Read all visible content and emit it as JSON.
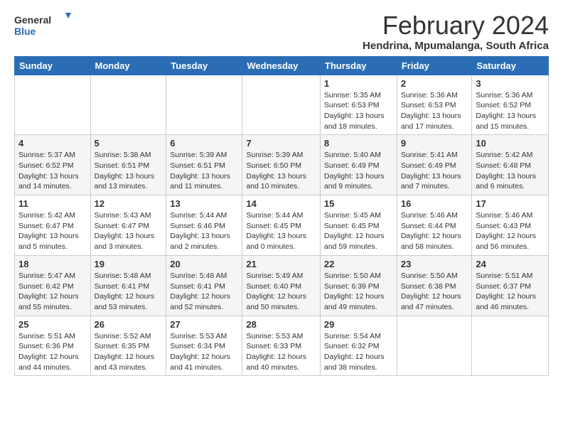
{
  "logo": {
    "general": "General",
    "blue": "Blue"
  },
  "title": "February 2024",
  "subtitle": "Hendrina, Mpumalanga, South Africa",
  "days_header": [
    "Sunday",
    "Monday",
    "Tuesday",
    "Wednesday",
    "Thursday",
    "Friday",
    "Saturday"
  ],
  "weeks": [
    [
      {
        "num": "",
        "info": ""
      },
      {
        "num": "",
        "info": ""
      },
      {
        "num": "",
        "info": ""
      },
      {
        "num": "",
        "info": ""
      },
      {
        "num": "1",
        "info": "Sunrise: 5:35 AM\nSunset: 6:53 PM\nDaylight: 13 hours and 18 minutes."
      },
      {
        "num": "2",
        "info": "Sunrise: 5:36 AM\nSunset: 6:53 PM\nDaylight: 13 hours and 17 minutes."
      },
      {
        "num": "3",
        "info": "Sunrise: 5:36 AM\nSunset: 6:52 PM\nDaylight: 13 hours and 15 minutes."
      }
    ],
    [
      {
        "num": "4",
        "info": "Sunrise: 5:37 AM\nSunset: 6:52 PM\nDaylight: 13 hours and 14 minutes."
      },
      {
        "num": "5",
        "info": "Sunrise: 5:38 AM\nSunset: 6:51 PM\nDaylight: 13 hours and 13 minutes."
      },
      {
        "num": "6",
        "info": "Sunrise: 5:39 AM\nSunset: 6:51 PM\nDaylight: 13 hours and 11 minutes."
      },
      {
        "num": "7",
        "info": "Sunrise: 5:39 AM\nSunset: 6:50 PM\nDaylight: 13 hours and 10 minutes."
      },
      {
        "num": "8",
        "info": "Sunrise: 5:40 AM\nSunset: 6:49 PM\nDaylight: 13 hours and 9 minutes."
      },
      {
        "num": "9",
        "info": "Sunrise: 5:41 AM\nSunset: 6:49 PM\nDaylight: 13 hours and 7 minutes."
      },
      {
        "num": "10",
        "info": "Sunrise: 5:42 AM\nSunset: 6:48 PM\nDaylight: 13 hours and 6 minutes."
      }
    ],
    [
      {
        "num": "11",
        "info": "Sunrise: 5:42 AM\nSunset: 6:47 PM\nDaylight: 13 hours and 5 minutes."
      },
      {
        "num": "12",
        "info": "Sunrise: 5:43 AM\nSunset: 6:47 PM\nDaylight: 13 hours and 3 minutes."
      },
      {
        "num": "13",
        "info": "Sunrise: 5:44 AM\nSunset: 6:46 PM\nDaylight: 13 hours and 2 minutes."
      },
      {
        "num": "14",
        "info": "Sunrise: 5:44 AM\nSunset: 6:45 PM\nDaylight: 13 hours and 0 minutes."
      },
      {
        "num": "15",
        "info": "Sunrise: 5:45 AM\nSunset: 6:45 PM\nDaylight: 12 hours and 59 minutes."
      },
      {
        "num": "16",
        "info": "Sunrise: 5:46 AM\nSunset: 6:44 PM\nDaylight: 12 hours and 58 minutes."
      },
      {
        "num": "17",
        "info": "Sunrise: 5:46 AM\nSunset: 6:43 PM\nDaylight: 12 hours and 56 minutes."
      }
    ],
    [
      {
        "num": "18",
        "info": "Sunrise: 5:47 AM\nSunset: 6:42 PM\nDaylight: 12 hours and 55 minutes."
      },
      {
        "num": "19",
        "info": "Sunrise: 5:48 AM\nSunset: 6:41 PM\nDaylight: 12 hours and 53 minutes."
      },
      {
        "num": "20",
        "info": "Sunrise: 5:48 AM\nSunset: 6:41 PM\nDaylight: 12 hours and 52 minutes."
      },
      {
        "num": "21",
        "info": "Sunrise: 5:49 AM\nSunset: 6:40 PM\nDaylight: 12 hours and 50 minutes."
      },
      {
        "num": "22",
        "info": "Sunrise: 5:50 AM\nSunset: 6:39 PM\nDaylight: 12 hours and 49 minutes."
      },
      {
        "num": "23",
        "info": "Sunrise: 5:50 AM\nSunset: 6:38 PM\nDaylight: 12 hours and 47 minutes."
      },
      {
        "num": "24",
        "info": "Sunrise: 5:51 AM\nSunset: 6:37 PM\nDaylight: 12 hours and 46 minutes."
      }
    ],
    [
      {
        "num": "25",
        "info": "Sunrise: 5:51 AM\nSunset: 6:36 PM\nDaylight: 12 hours and 44 minutes."
      },
      {
        "num": "26",
        "info": "Sunrise: 5:52 AM\nSunset: 6:35 PM\nDaylight: 12 hours and 43 minutes."
      },
      {
        "num": "27",
        "info": "Sunrise: 5:53 AM\nSunset: 6:34 PM\nDaylight: 12 hours and 41 minutes."
      },
      {
        "num": "28",
        "info": "Sunrise: 5:53 AM\nSunset: 6:33 PM\nDaylight: 12 hours and 40 minutes."
      },
      {
        "num": "29",
        "info": "Sunrise: 5:54 AM\nSunset: 6:32 PM\nDaylight: 12 hours and 38 minutes."
      },
      {
        "num": "",
        "info": ""
      },
      {
        "num": "",
        "info": ""
      }
    ]
  ]
}
